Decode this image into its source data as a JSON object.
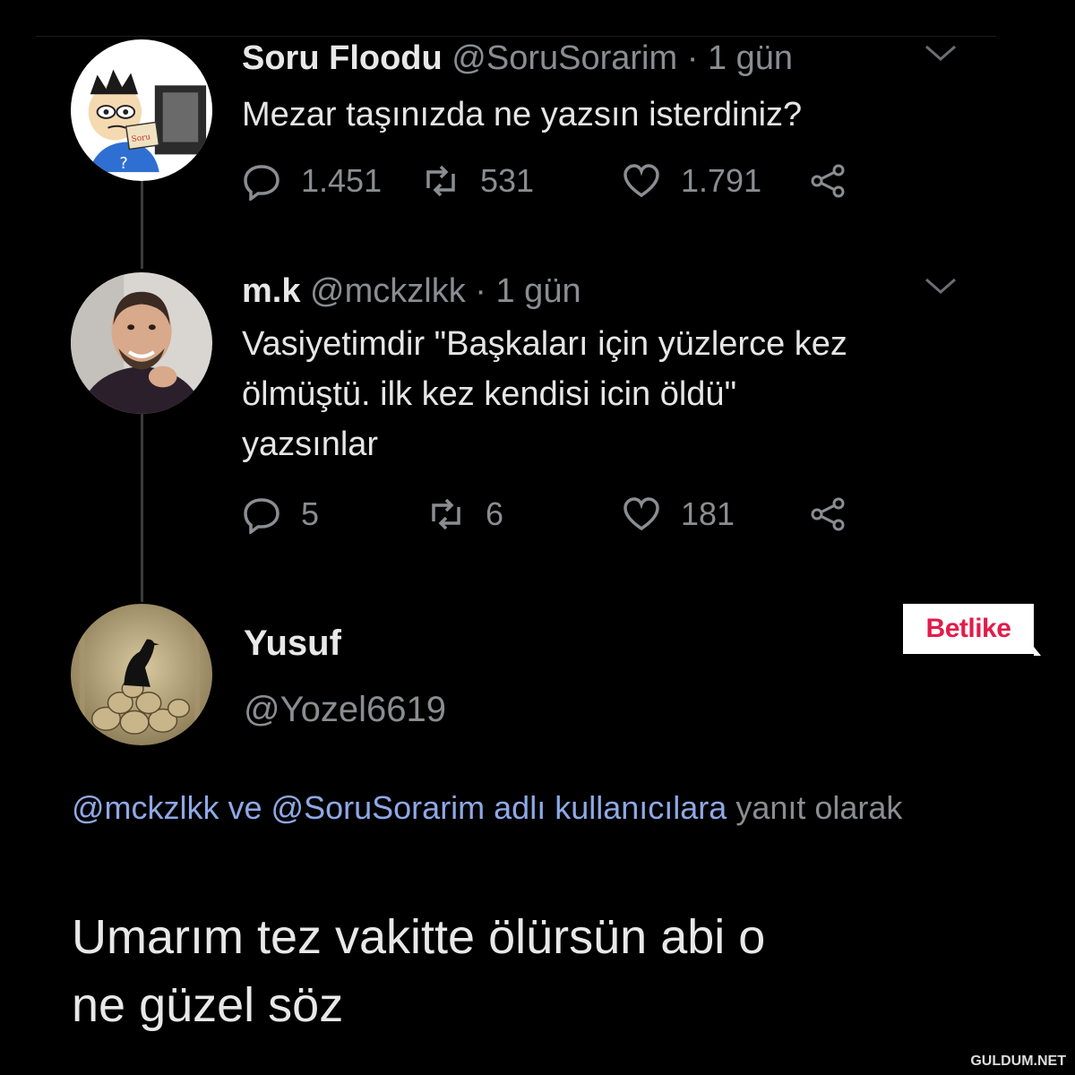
{
  "tweets": [
    {
      "name": "Soru Floodu",
      "handle": "@SoruSorarim",
      "time": "· 1 gün",
      "text_lines": [
        "Mezar taşınızda ne yazsın isterdiniz?"
      ],
      "replies": "1.451",
      "retweets": "531",
      "likes": "1.791"
    },
    {
      "name": "m.k",
      "handle": "@mckzlkk",
      "time": "· 1 gün",
      "text_lines": [
        "Vasiyetimdir \"Başkaları için yüzlerce kez",
        "ölmüştü. ilk kez kendisi icin öldü\"",
        "yazsınlar"
      ],
      "replies": "5",
      "retweets": "6",
      "likes": "181"
    }
  ],
  "reply": {
    "name": "Yusuf",
    "handle": "@Yozel6619",
    "reply_to_mentions": "@mckzlkk ve @SoruSorarim adlı kullanıcılara",
    "reply_to_suffix": " yanıt olarak",
    "text_lines": [
      "Umarım tez vakitte ölürsün abi o",
      "ne güzel söz"
    ]
  },
  "watermark": "Betlike",
  "credit": "GULDUM.NET",
  "icons": {
    "avatar_1": "cartoon-avatar",
    "avatar_2": "man-avatar",
    "avatar_3": "raven-on-skulls-avatar",
    "reply": "comment-bubble-icon",
    "retweet": "retweet-icon",
    "like": "heart-icon",
    "share": "share-icon",
    "menu": "chevron-down-icon"
  },
  "colors": {
    "background": "#000000",
    "text": "#e6e6e6",
    "muted": "#8a8d91",
    "mention": "#8fa8e6",
    "watermark": "#e21c4a"
  }
}
